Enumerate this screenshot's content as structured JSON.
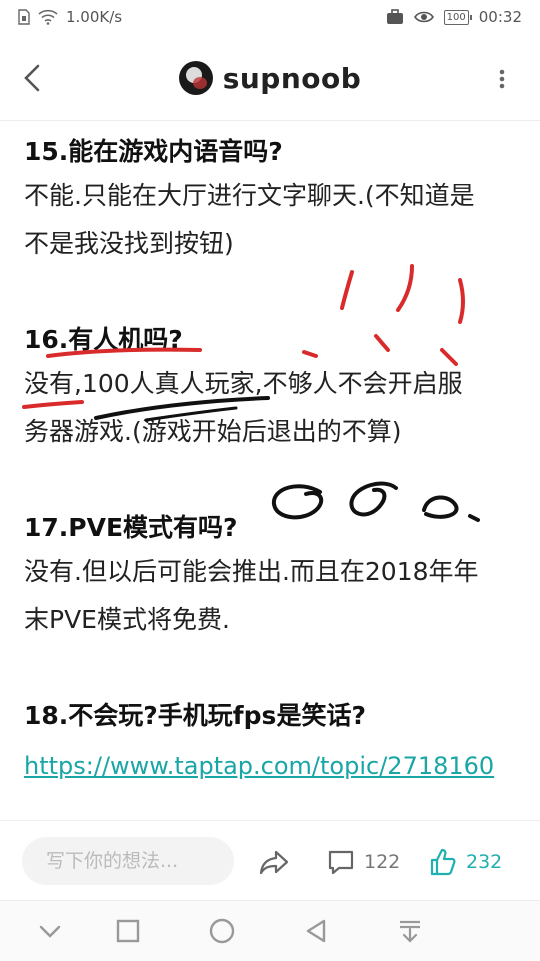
{
  "status_bar": {
    "network_speed": "1.00K/s",
    "battery_level": "100",
    "time": "00:32"
  },
  "header": {
    "title": "supnoob"
  },
  "faq": [
    {
      "question": "15.能在游戏内语音吗?",
      "answer_lines": [
        "不能.只能在大厅进行文字聊天.(不知道是",
        "不是我没找到按钮)"
      ]
    },
    {
      "question": "16.有人机吗?",
      "answer_lines": [
        "没有,100人真人玩家,不够人不会开启服",
        "务器游戏.(游戏开始后退出的不算)"
      ]
    },
    {
      "question": "17.PVE模式有吗?",
      "answer_lines": [
        "没有.但以后可能会推出.而且在2018年年",
        "末PVE模式将免费."
      ]
    },
    {
      "question": "18.不会玩?手机玩fps是笑话?",
      "link": "https://www.taptap.com/topic/2718160"
    }
  ],
  "action_bar": {
    "comment_placeholder": "写下你的想法...",
    "comment_count": "122",
    "like_count": "232",
    "accent_color": "#20b0b0"
  },
  "icons": {
    "status_left": [
      "sim-icon",
      "wifi-icon"
    ],
    "status_right": [
      "briefcase-icon",
      "eye-icon",
      "battery-icon"
    ],
    "nav": [
      "chevron-down-icon",
      "square-icon",
      "circle-icon",
      "triangle-back-icon",
      "download-icon"
    ]
  }
}
